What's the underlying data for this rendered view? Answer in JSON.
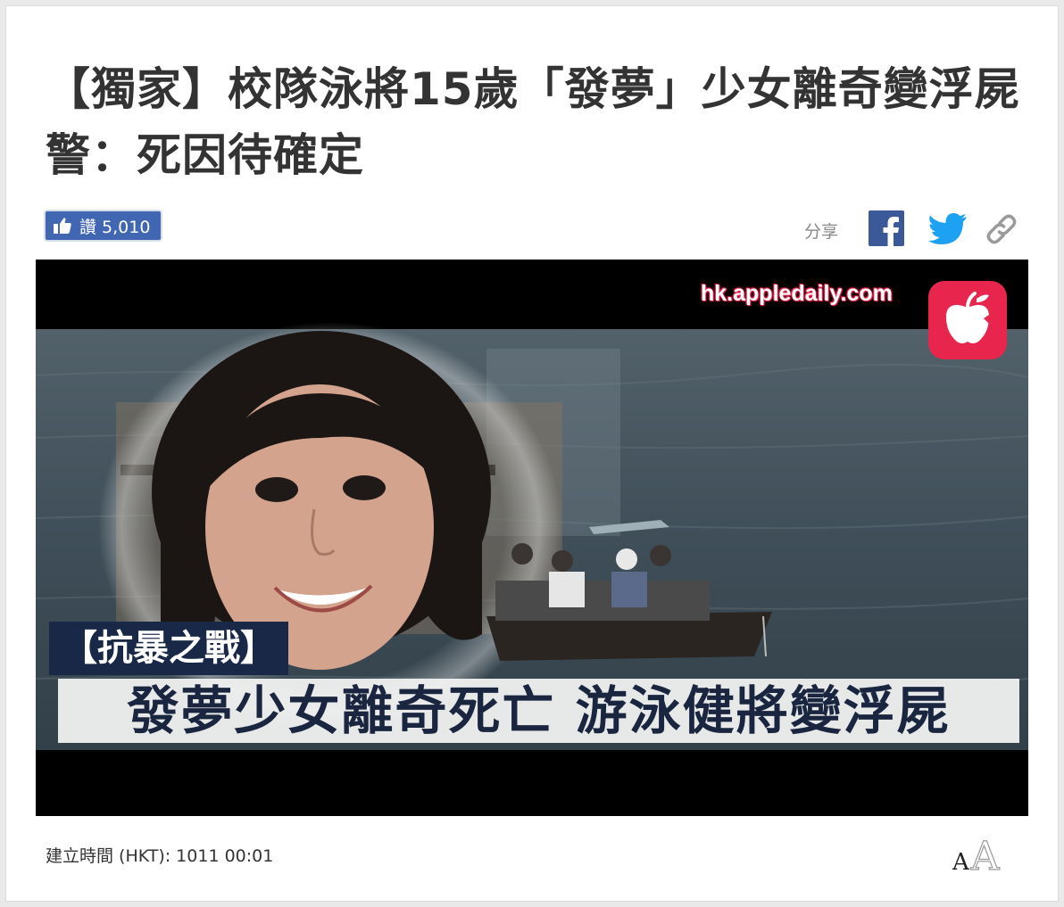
{
  "article": {
    "headline": "【獨家】校隊泳將15歲「發夢」少女離奇變浮屍 警：死因待確定",
    "timestamp": "建立時間 (HKT): 1011 00:01"
  },
  "like": {
    "icon": "thumbs-up-icon",
    "label": "讚 5,010"
  },
  "share": {
    "label": "分享",
    "icons": [
      "facebook-icon",
      "twitter-icon",
      "link-icon"
    ]
  },
  "video": {
    "watermark": "hk.appledaily.com",
    "tag": "【抗暴之戰】",
    "caption": "發夢少女離奇死亡 游泳健將變浮屍"
  },
  "font_size_control": {
    "small": "A",
    "large": "A"
  },
  "colors": {
    "facebook": "#3b5998",
    "twitter": "#1da1f2",
    "like_button": "#4267b2",
    "apple_logo": "#e8264d"
  }
}
